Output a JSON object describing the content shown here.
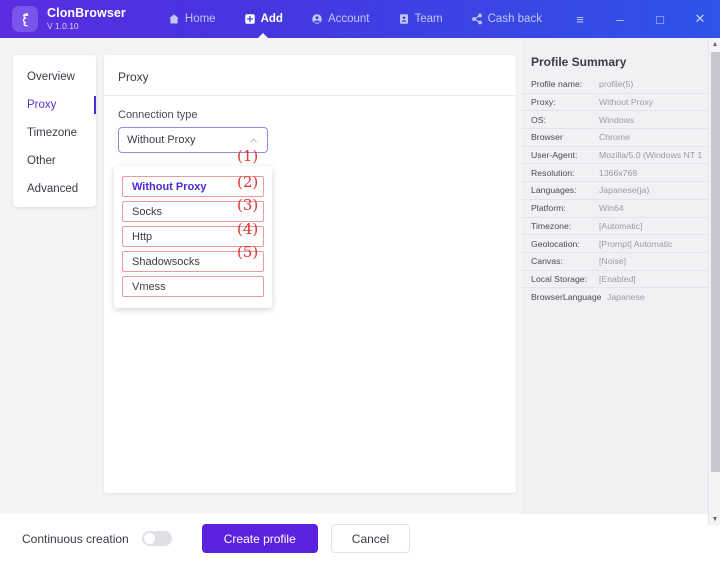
{
  "titlebar": {
    "brand_name": "ClonBrowser",
    "version": "V 1.0.10",
    "nav": [
      {
        "label": "Home",
        "icon": "home-icon",
        "active": false
      },
      {
        "label": "Add",
        "icon": "add-square-icon",
        "active": true
      },
      {
        "label": "Account",
        "icon": "account-circle-icon",
        "active": false
      },
      {
        "label": "Team",
        "icon": "team-badge-icon",
        "active": false
      },
      {
        "label": "Cash back",
        "icon": "share-icon",
        "active": false
      }
    ],
    "window_controls": [
      {
        "name": "menu-button",
        "glyph": "≡"
      },
      {
        "name": "minimize-button",
        "glyph": "–"
      },
      {
        "name": "maximize-button",
        "glyph": "□"
      },
      {
        "name": "close-button",
        "glyph": "✕"
      }
    ]
  },
  "sidebar": {
    "items": [
      {
        "label": "Overview",
        "active": false
      },
      {
        "label": "Proxy",
        "active": true
      },
      {
        "label": "Timezone",
        "active": false
      },
      {
        "label": "Other",
        "active": false
      },
      {
        "label": "Advanced",
        "active": false
      }
    ]
  },
  "main": {
    "section_title": "Proxy",
    "field_label": "Connection type",
    "select_value": "Without Proxy",
    "chevron": "chevron-up-icon",
    "dropdown_options": [
      {
        "label": "Without Proxy",
        "annotation": "(1)",
        "selected": true
      },
      {
        "label": "Socks",
        "annotation": "(2)",
        "selected": false
      },
      {
        "label": "Http",
        "annotation": "(3)",
        "selected": false
      },
      {
        "label": "Shadowsocks",
        "annotation": "(4)",
        "selected": false
      },
      {
        "label": "Vmess",
        "annotation": "(5)",
        "selected": false
      }
    ]
  },
  "summary": {
    "title": "Profile Summary",
    "rows": [
      {
        "key": "Profile name:",
        "value": "profile(5)"
      },
      {
        "key": "Proxy:",
        "value": "Without Proxy"
      },
      {
        "key": "OS:",
        "value": "Windows"
      },
      {
        "key": "Browser",
        "value": "Chrome"
      },
      {
        "key": "User-Agent:",
        "value": "Mozilla/5.0 (Windows NT 1..."
      },
      {
        "key": "Resolution:",
        "value": "1366x768"
      },
      {
        "key": "Languages:",
        "value": "Japanese(ja)"
      },
      {
        "key": "Platform:",
        "value": "Win64"
      },
      {
        "key": "Timezone:",
        "value": "[Automatic]"
      },
      {
        "key": "Geolocation:",
        "value": "[Prompt] Automatic"
      },
      {
        "key": "Canvas:",
        "value": "[Noise]"
      },
      {
        "key": "Local Storage:",
        "value": "[Enabled]"
      },
      {
        "key": "BrowserLanguage",
        "value": "Japanese"
      }
    ]
  },
  "footer": {
    "continuous_label": "Continuous creation",
    "toggle_state": "off",
    "create_label": "Create profile",
    "cancel_label": "Cancel"
  },
  "colors": {
    "brand_purple": "#5b21e0",
    "nav_gradient_start": "#5b2de0",
    "nav_gradient_end": "#2f53e8",
    "active_tab": "#5a30e0",
    "annotation_red": "#e03131",
    "annotation_box": "#e99a9a"
  }
}
